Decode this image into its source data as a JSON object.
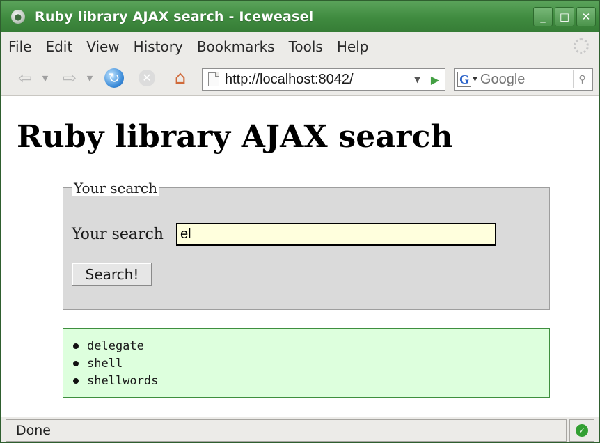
{
  "window": {
    "title": "Ruby library AJAX search - Iceweasel",
    "buttons": {
      "minimize": "_",
      "maximize": "□",
      "close": "✕"
    }
  },
  "menu": {
    "items": [
      "File",
      "Edit",
      "View",
      "History",
      "Bookmarks",
      "Tools",
      "Help"
    ]
  },
  "toolbar": {
    "url": "http://localhost:8042/",
    "search_engine": "G",
    "search_placeholder": "Google"
  },
  "page": {
    "title": "Ruby library AJAX search",
    "form": {
      "legend": "Your search",
      "label": "Your search",
      "value": "el",
      "button": "Search!"
    },
    "results": [
      "delegate",
      "shell",
      "shellwords"
    ]
  },
  "status": {
    "text": "Done"
  },
  "colors": {
    "titlebar": "#4a944a",
    "input_bg": "#ffffdd",
    "results_bg": "#ddffdd",
    "results_border": "#3f8f3f",
    "fieldset_bg": "#dadada"
  }
}
